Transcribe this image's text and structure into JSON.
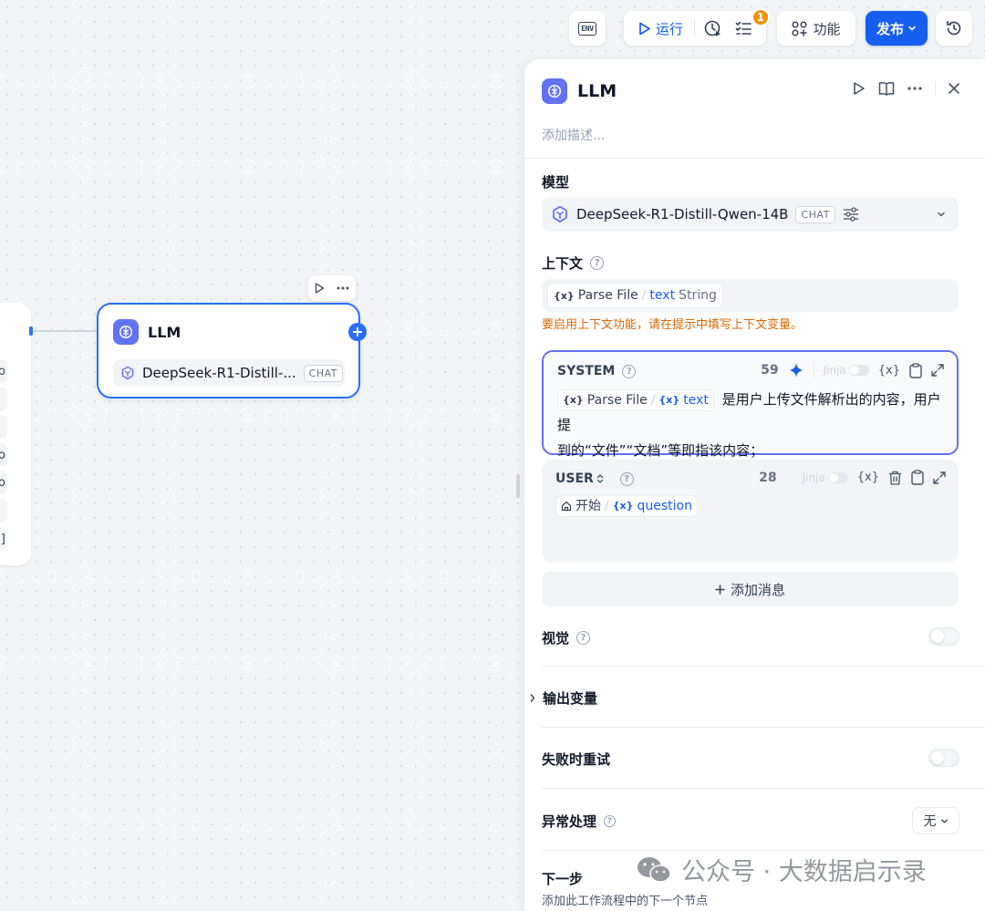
{
  "toolbar": {
    "env_label": "ENV",
    "run_label": "运行",
    "badge_count": "1",
    "feature_label": "功能",
    "publish_label": "发布"
  },
  "canvas": {
    "left_node_rows": [
      "to",
      "",
      "",
      "lo",
      "to",
      "",
      "[]"
    ],
    "llm_node": {
      "title": "LLM",
      "model_name": "DeepSeek-R1-Distill-...",
      "model_tag": "CHAT"
    }
  },
  "panel": {
    "title": "LLM",
    "description_placeholder": "添加描述...",
    "model_section": {
      "label": "模型",
      "model_name": "DeepSeek-R1-Distill-Qwen-14B",
      "model_tag": "CHAT"
    },
    "context_section": {
      "label": "上下文",
      "var_node": "Parse File",
      "var_name": "text",
      "var_type": "String",
      "warning": "要启用上下文功能，请在提示中填写上下文变量。"
    },
    "system_prompt": {
      "role": "SYSTEM",
      "count": "59",
      "jinja_label": "Jinja",
      "var_node": "Parse File",
      "var_name": "text",
      "text_line1": "是用户上传文件解析出的内容，用户提",
      "text_line2": "到的“文件”“文档”等即指该内容；"
    },
    "user_prompt": {
      "role": "USER",
      "count": "28",
      "jinja_label": "Jinja",
      "var_node": "开始",
      "var_name": "question"
    },
    "add_message_label": "添加消息",
    "vision_label": "视觉",
    "output_vars_label": "输出变量",
    "retry_label": "失败时重试",
    "exception_label": "异常处理",
    "exception_value": "无",
    "next_step_label": "下一步",
    "next_step_desc": "添加此工作流程中的下一个节点"
  },
  "watermark": {
    "text": "公众号 · 大数据启示录"
  },
  "colors": {
    "primary": "#155eef",
    "node_border": "#296dff",
    "llm_icon_bg": "#6172f3",
    "warning": "#dc6803",
    "badge": "#f79009"
  }
}
